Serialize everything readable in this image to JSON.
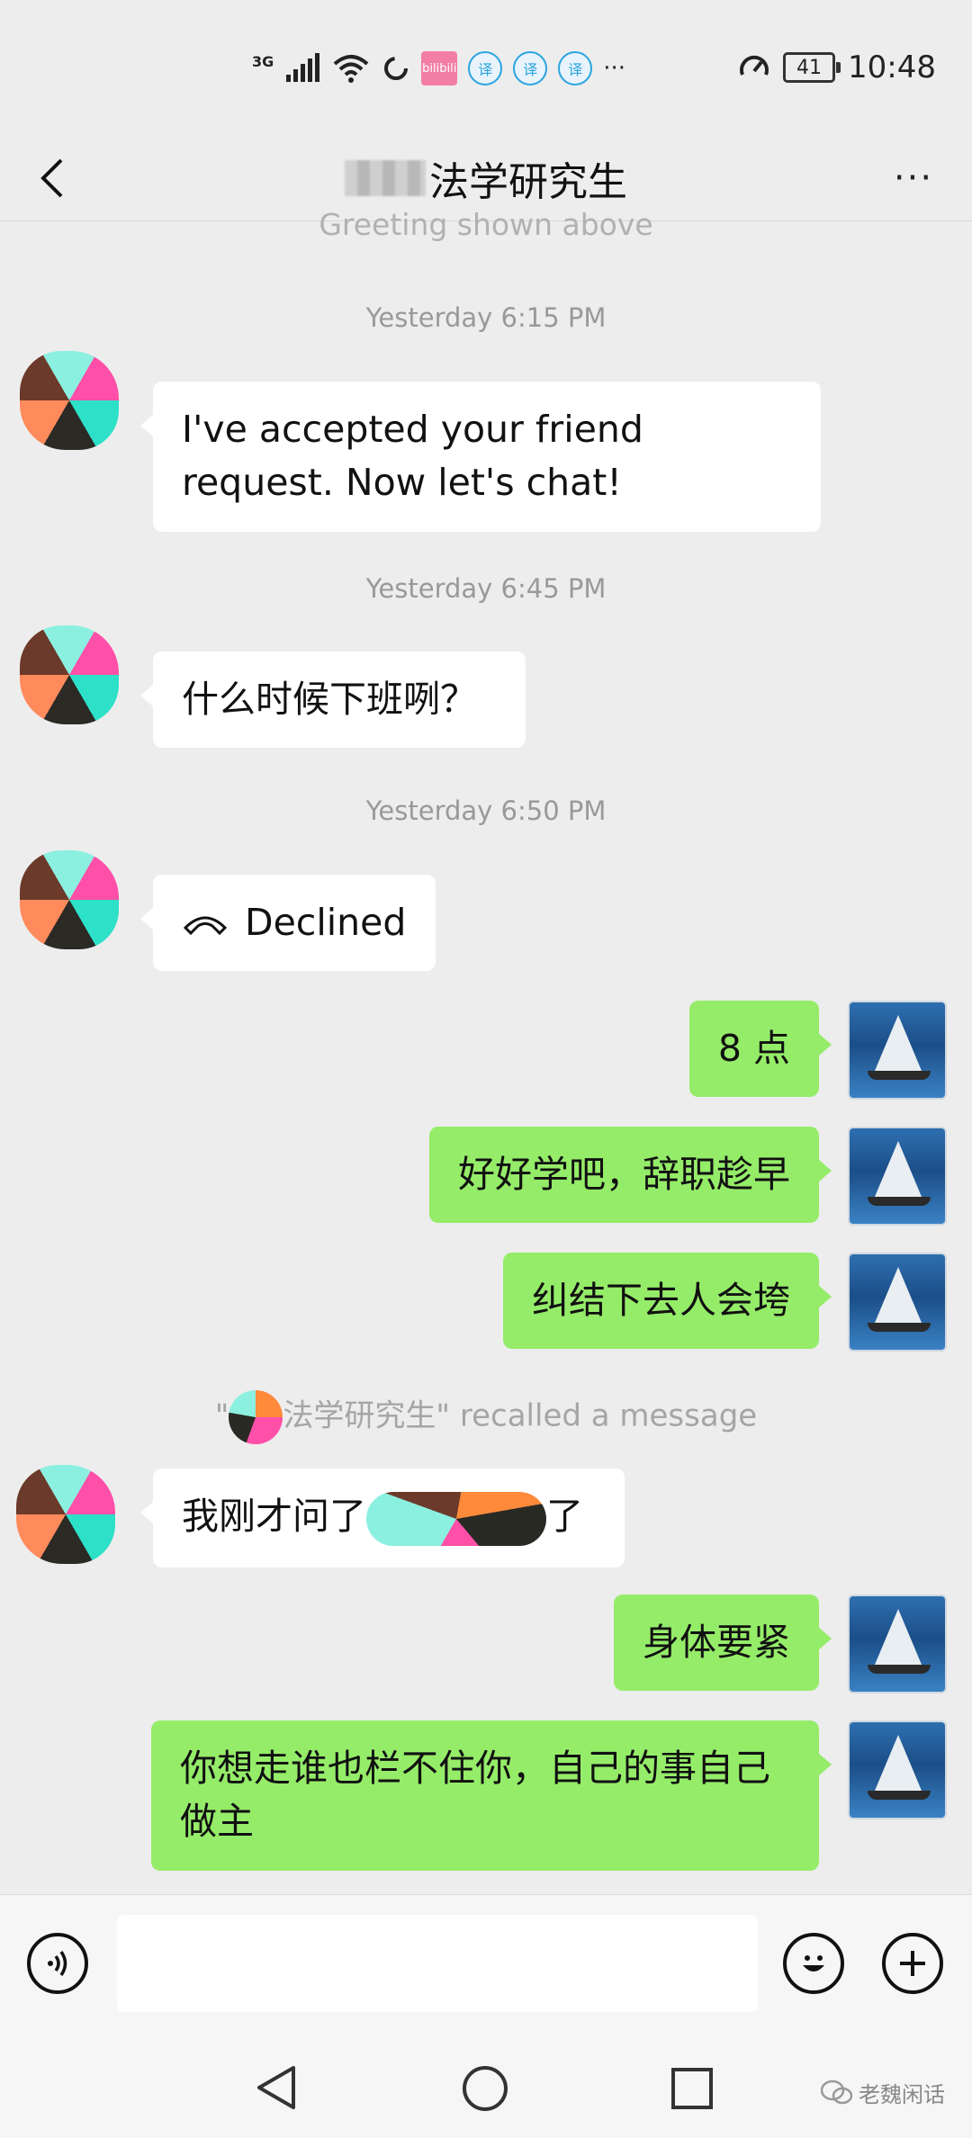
{
  "status_bar": {
    "network": "3G",
    "battery": "41",
    "time": "10:48",
    "more": "···",
    "app_badge": "bilibili"
  },
  "header": {
    "title": "法学研究生",
    "more": "···"
  },
  "chat": {
    "greeting": "Greeting shown above",
    "ts1": "Yesterday 6:15 PM",
    "msg1": "I've accepted your friend request. Now let's chat!",
    "ts2": "Yesterday 6:45 PM",
    "msg2": "什么时候下班咧？",
    "ts3": "Yesterday 6:50 PM",
    "call_label": "Declined",
    "out1": "8 点",
    "out2": "好好学吧，辞职趁早",
    "out3": "纠结下去人会垮",
    "recall_quote_open": "\"",
    "recall_text": "法学研究生\" recalled a message",
    "msg3_start": "我刚才问了",
    "msg3_end": "了",
    "out4": "身体要紧",
    "out5": "你想走谁也栏不住你，自己的事自己做主"
  },
  "watermark": "老魏闲话"
}
